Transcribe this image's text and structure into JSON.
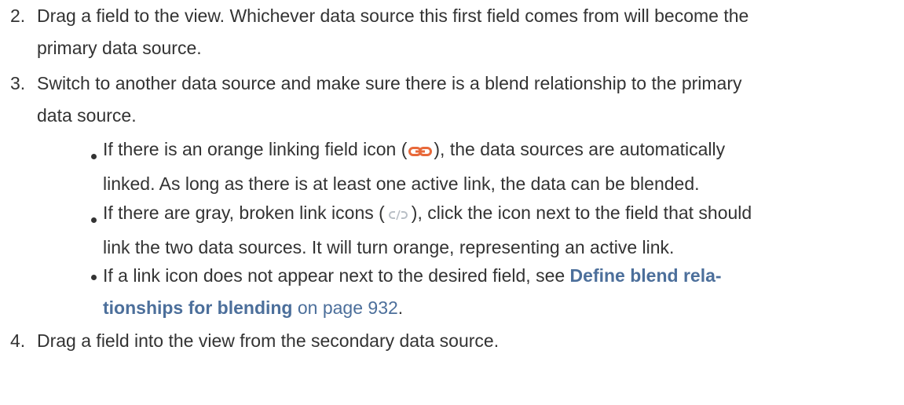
{
  "steps": [
    {
      "number": "2.",
      "lines": [
        "Drag a field to the view. Whichever data source this first field comes from will become the",
        "primary data source."
      ]
    },
    {
      "number": "3.",
      "lines": [
        "Switch to another data source and make sure there is a blend relationship to the primary",
        "data source."
      ],
      "bullets": [
        {
          "before_icon": "If there is an orange linking field icon (",
          "icon": "orange-link-icon",
          "after_icon": "), the data sources are automatically",
          "line2": "linked. As long as there is at least one active link, the data can be blended."
        },
        {
          "before_icon": "If there are gray, broken link icons (",
          "icon": "gray-broken-link-icon",
          "after_icon": "), click the icon next to the field that should",
          "line2": "link the two data sources. It will turn orange, representing an active link."
        },
        {
          "line1": "If a link icon does not appear next to the desired field, see ",
          "link_bold_1": "Define blend rela-",
          "link_bold_2": "tionships for blending",
          "link_plain": " on page 932",
          "end": "."
        }
      ]
    },
    {
      "number": "4.",
      "lines": [
        "Drag a field into the view from the secondary data source."
      ]
    }
  ],
  "colors": {
    "text": "#333333",
    "link": "#4c6f9b",
    "orange_link": "#e8693a",
    "gray_link": "#b9bfc6"
  }
}
